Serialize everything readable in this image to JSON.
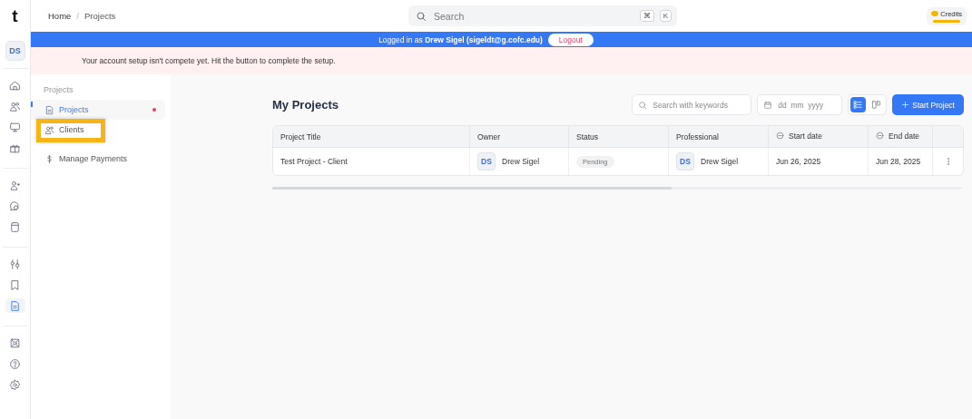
{
  "app": {
    "logo": "t"
  },
  "breadcrumb": {
    "separator": "/",
    "items": [
      "Home",
      "Projects"
    ]
  },
  "search": {
    "placeholder": "Search",
    "shortcut": [
      "⌘",
      "K"
    ]
  },
  "credits": {
    "label": "Credits"
  },
  "rail": {
    "avatar": "DS",
    "groups": [
      [
        {
          "selected": false
        },
        {
          "selected": false
        },
        {
          "selected": false
        },
        {
          "selected": false
        }
      ],
      [
        {
          "selected": false
        },
        {
          "selected": false
        },
        {
          "selected": false
        }
      ],
      [
        {
          "selected": false
        },
        {
          "selected": false
        },
        {
          "selected": true
        }
      ],
      [
        {
          "selected": false
        },
        {
          "selected": false
        },
        {
          "selected": false
        }
      ]
    ]
  },
  "login_banner": {
    "text": "Logged in as **Drew Sigel (sigeldt@g.cofc.edu)**",
    "button": "Logout"
  },
  "setup_notice": {
    "text": "Your account setup isn't compete yet. Hit the button to complete the setup."
  },
  "sidebar": {
    "heading": "Projects",
    "items": [
      {
        "label": "Projects",
        "selected": true,
        "notification": true,
        "highlighted": false
      },
      {
        "label": "Clients",
        "selected": false,
        "notification": false,
        "highlighted": true
      },
      {
        "label": "Manage Payments",
        "selected": false,
        "notification": false,
        "highlighted": false
      }
    ]
  },
  "main": {
    "title": "My Projects",
    "search": {
      "placeholder": "Search with keywords"
    },
    "date": {
      "placeholder": "dd  mm  yyyy"
    },
    "views": [
      {
        "selected": true
      },
      {
        "selected": false
      }
    ],
    "start_button": "Start Project",
    "table": {
      "columns": [
        {
          "label": "Project Title",
          "kind": "text"
        },
        {
          "label": "Owner",
          "kind": "text"
        },
        {
          "label": "Status",
          "kind": "text"
        },
        {
          "label": "Professional",
          "kind": "text"
        },
        {
          "label": "Start date",
          "kind": "date"
        },
        {
          "label": "End date",
          "kind": "date"
        }
      ],
      "rows": [
        {
          "title": "Test Project - Client",
          "owner": {
            "initials": "DS",
            "name": "Drew Sigel"
          },
          "status": "Pending",
          "professional": {
            "initials": "DS",
            "name": "Drew Sigel"
          },
          "start": "Jun 26, 2025",
          "end": "Jun 28, 2025"
        }
      ]
    }
  }
}
